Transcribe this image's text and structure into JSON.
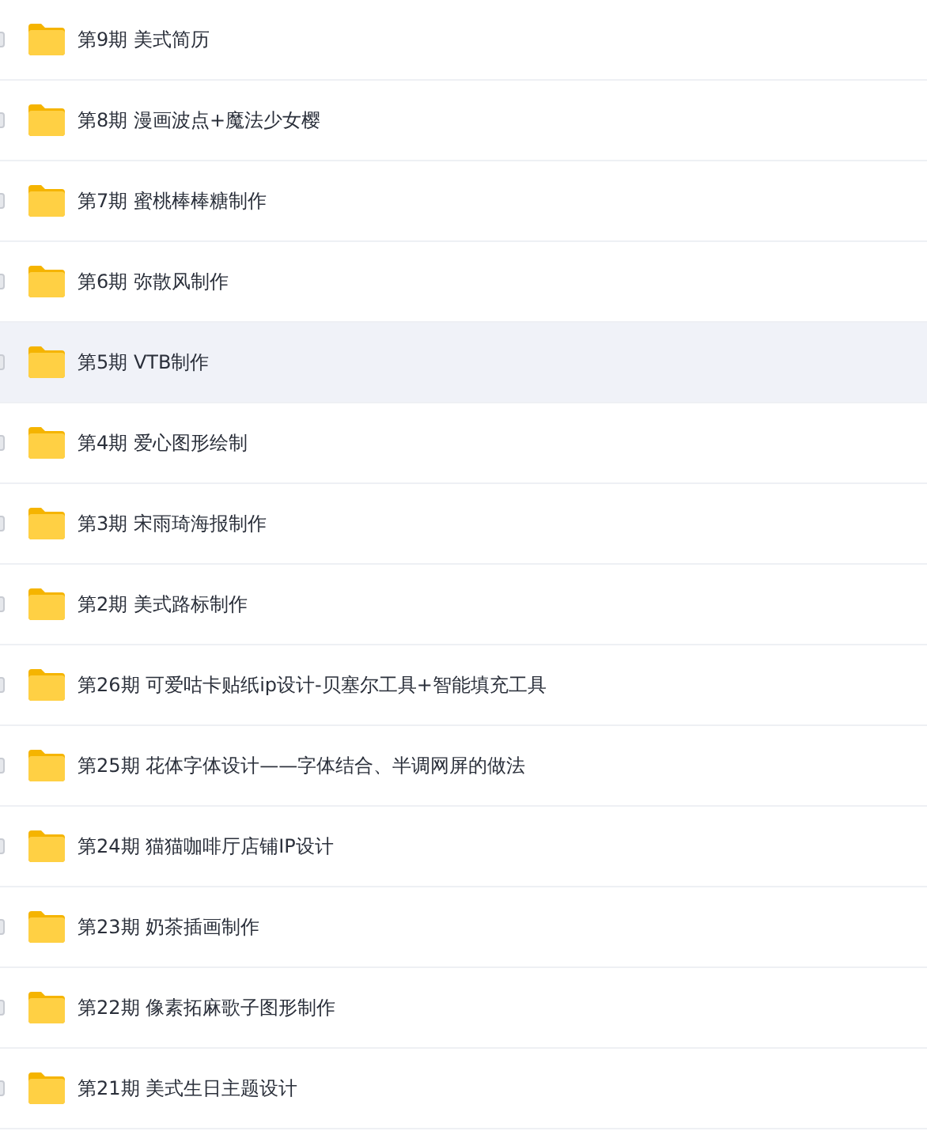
{
  "folders": [
    {
      "name": "第9期 美式简历",
      "selected": false,
      "checked": false
    },
    {
      "name": "第8期 漫画波点+魔法少女樱",
      "selected": false,
      "checked": false
    },
    {
      "name": "第7期 蜜桃棒棒糖制作",
      "selected": false,
      "checked": false
    },
    {
      "name": "第6期 弥散风制作",
      "selected": false,
      "checked": false
    },
    {
      "name": "第5期 VTB制作",
      "selected": true,
      "checked": false
    },
    {
      "name": "第4期 爱心图形绘制",
      "selected": false,
      "checked": false
    },
    {
      "name": "第3期 宋雨琦海报制作",
      "selected": false,
      "checked": false
    },
    {
      "name": "第2期 美式路标制作",
      "selected": false,
      "checked": false
    },
    {
      "name": "第26期 可爱咕卡贴纸ip设计-贝塞尔工具+智能填充工具",
      "selected": false,
      "checked": false
    },
    {
      "name": "第25期 花体字体设计——字体结合、半调网屏的做法",
      "selected": false,
      "checked": false
    },
    {
      "name": "第24期 猫猫咖啡厅店铺IP设计",
      "selected": false,
      "checked": false
    },
    {
      "name": "第23期 奶茶插画制作",
      "selected": false,
      "checked": false
    },
    {
      "name": "第22期 像素拓麻歌子图形制作",
      "selected": false,
      "checked": false
    },
    {
      "name": "第21期 美式生日主题设计",
      "selected": false,
      "checked": false
    }
  ]
}
